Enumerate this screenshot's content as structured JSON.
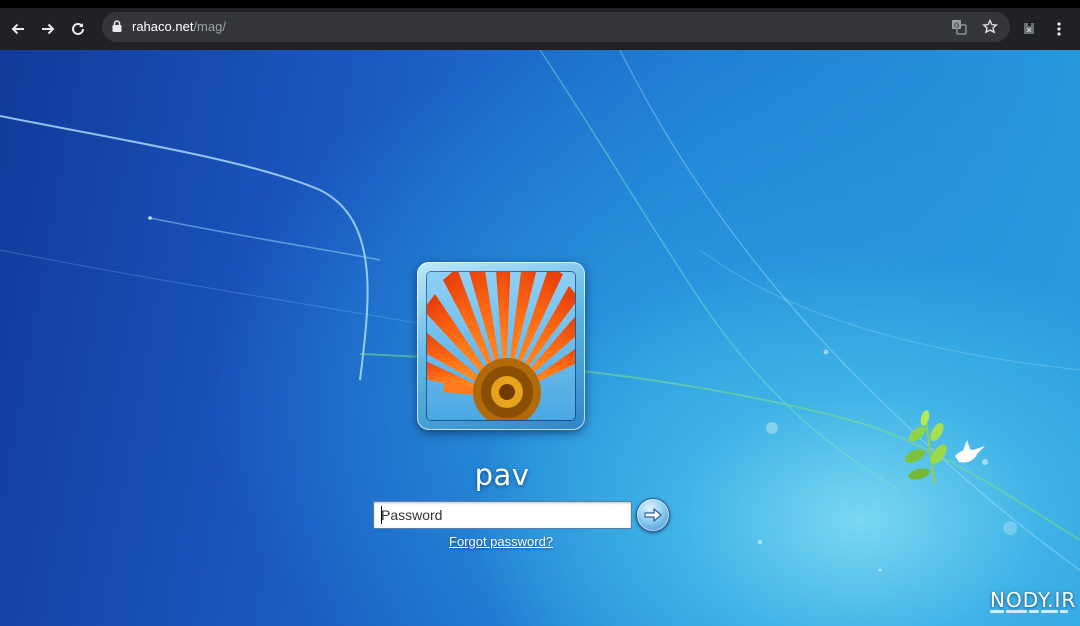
{
  "browser": {
    "url_domain": "rahaco.net",
    "url_path": "/mag/",
    "icons": [
      "back-arrow-icon",
      "forward-arrow-icon",
      "reload-icon",
      "lock-icon",
      "translate-icon",
      "star-icon",
      "extension-icon",
      "menu-dots-icon"
    ]
  },
  "login": {
    "username": "pav",
    "password_placeholder": "Password",
    "password_value": "",
    "forgot_link": "Forgot password?",
    "submit_icon": "arrow-right-icon",
    "avatar": "orange-flower-avatar"
  },
  "watermark": {
    "text": "NODY.IR"
  },
  "colors": {
    "chrome_bg": "#202124",
    "omnibox_bg": "#35363a",
    "desktop_dark": "#123a9c",
    "desktop_light": "#7ad8f3",
    "text_white": "#ffffff"
  }
}
